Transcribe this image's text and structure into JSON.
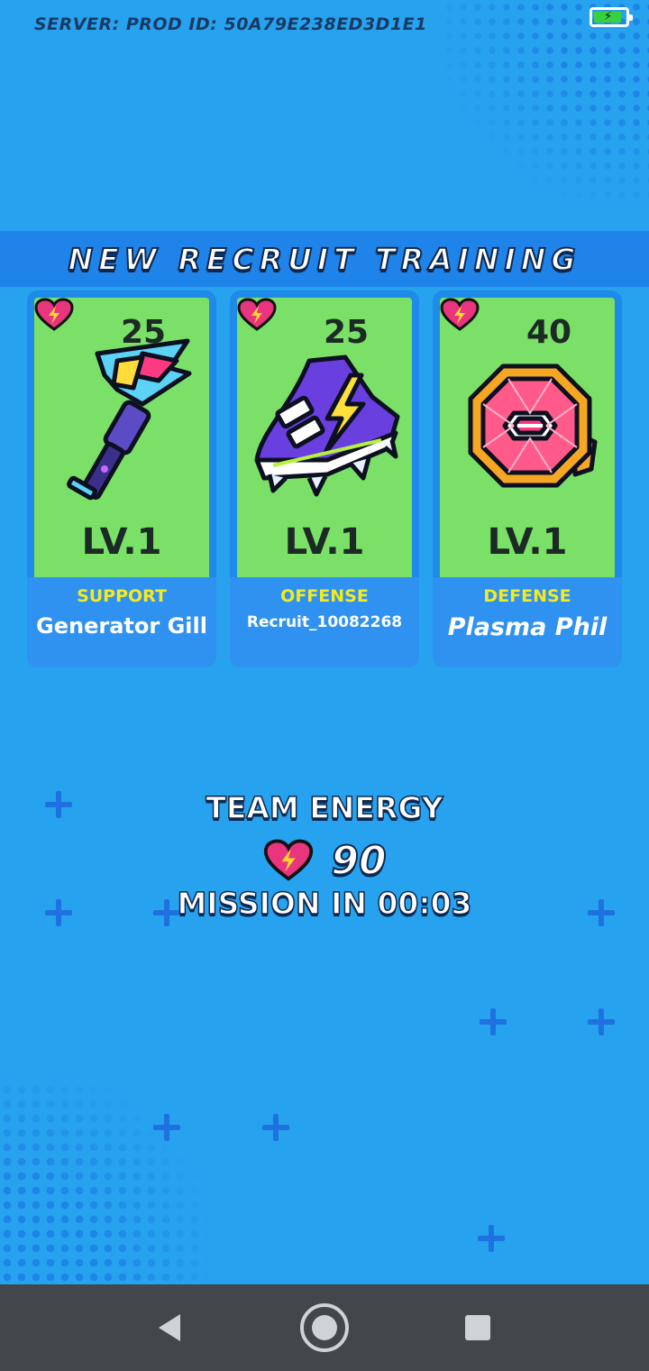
{
  "status": {
    "server_label": "SERVER: PROD ID: 50A79E238ED3D1E1",
    "battery_icon": "battery-charging-icon"
  },
  "banner": {
    "title": "NEW RECRUIT TRAINING"
  },
  "cards": [
    {
      "energy": "25",
      "level": "LV.1",
      "role": "SUPPORT",
      "name": "Generator Gill",
      "art_icon": "plasma-blaster-icon"
    },
    {
      "energy": "25",
      "level": "LV.1",
      "role": "OFFENSE",
      "name": "Recruit_10082268",
      "art_icon": "lightning-sneaker-icon"
    },
    {
      "energy": "40",
      "level": "LV.1",
      "role": "DEFENSE",
      "name": "Plasma Phil",
      "art_icon": "gem-shield-icon"
    }
  ],
  "team": {
    "label": "TEAM ENERGY",
    "energy": "90",
    "mission": "MISSION IN 00:03"
  },
  "colors": {
    "background": "#27a2ef",
    "card_art": "#7be067",
    "role_text": "#f5ea1e",
    "heart": "#e8357d"
  },
  "navbar": {
    "back_icon": "back-triangle-icon",
    "home_icon": "home-circle-icon",
    "recents_icon": "recents-square-icon"
  }
}
